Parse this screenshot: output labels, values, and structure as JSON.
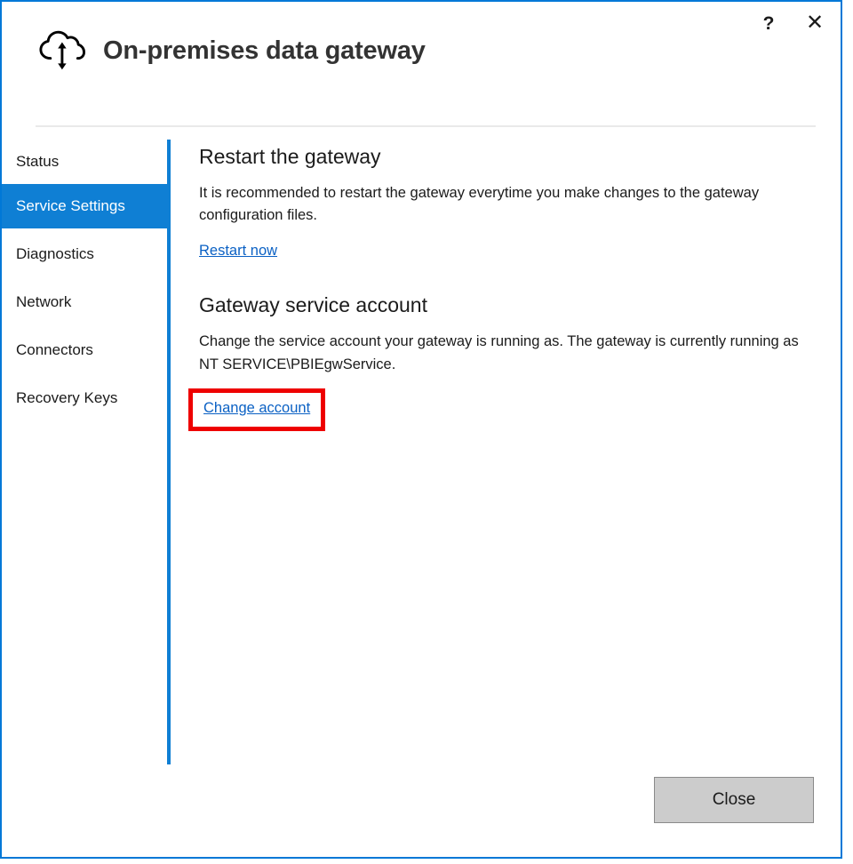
{
  "window": {
    "title": "On-premises data gateway",
    "brand_icon": "cloud-up-down-arrow-icon",
    "accent_color": "#0078d7",
    "selected_nav_color": "#0f7fd4",
    "link_color": "#0b61c4",
    "highlight_color": "#ee0000",
    "controls": {
      "help_label": "?",
      "close_label": "✕"
    }
  },
  "sidebar": {
    "items": [
      {
        "label": "Status",
        "selected": false
      },
      {
        "label": "Service Settings",
        "selected": true
      },
      {
        "label": "Diagnostics",
        "selected": false
      },
      {
        "label": "Network",
        "selected": false
      },
      {
        "label": "Connectors",
        "selected": false
      },
      {
        "label": "Recovery Keys",
        "selected": false
      }
    ]
  },
  "main": {
    "sections": [
      {
        "heading": "Restart the gateway",
        "body": "It is recommended to restart the gateway everytime you make changes to the gateway configuration files.",
        "link": "Restart now"
      },
      {
        "heading": "Gateway service account",
        "body": "Change the service account your gateway is running as. The gateway is currently running as NT SERVICE\\PBIEgwService.",
        "link": "Change account"
      }
    ]
  },
  "footer": {
    "close_label": "Close"
  }
}
